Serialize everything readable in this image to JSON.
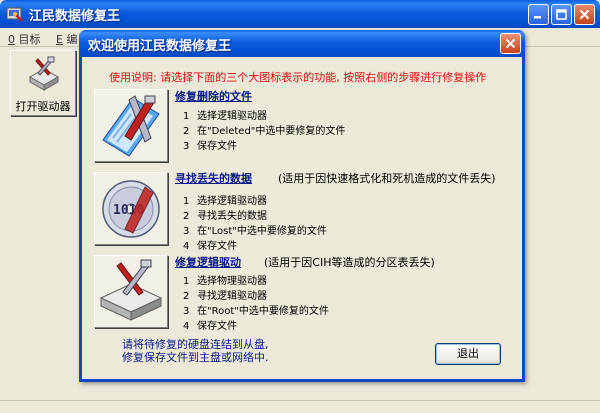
{
  "main_window": {
    "title": "江民数据修复王",
    "menu": [
      {
        "hotkey": "0",
        "label": "目标"
      },
      {
        "hotkey": "E",
        "label": "编"
      }
    ],
    "toolbar": {
      "open_drive_label": "打开驱动器"
    }
  },
  "dialog": {
    "title": "欢迎使用江民数据修复王",
    "instruction": "使用说明: 请选择下面的三个大图标表示的功能, 按照右侧的步骤进行修复操作",
    "sections": [
      {
        "title": "修复删除的文件",
        "note": "",
        "icon": "recycle-document-icon",
        "steps": [
          {
            "num": "1",
            "text": "选择逻辑驱动器"
          },
          {
            "num": "2",
            "text": "在\"Deleted\"中选中要修复的文件"
          },
          {
            "num": "3",
            "text": "保存文件"
          }
        ]
      },
      {
        "title": "寻找丢失的数据",
        "note": "(适用于因快速格式化和死机造成的文件丢失)",
        "icon": "binary-disk-icon",
        "steps": [
          {
            "num": "1",
            "text": "选择逻辑驱动器"
          },
          {
            "num": "2",
            "text": "寻找丢失的数据"
          },
          {
            "num": "3",
            "text": "在\"Lost\"中选中要修复的文件"
          },
          {
            "num": "4",
            "text": "保存文件"
          }
        ]
      },
      {
        "title": "修复逻辑驱动",
        "note": "(适用于因CIH等造成的分区表丢失)",
        "icon": "hard-drive-tools-icon",
        "steps": [
          {
            "num": "1",
            "text": "选择物理驱动器"
          },
          {
            "num": "2",
            "text": "寻找逻辑驱动器"
          },
          {
            "num": "3",
            "text": "在\"Root\"中选中要修复的文件"
          },
          {
            "num": "4",
            "text": "保存文件"
          }
        ]
      }
    ],
    "note_lines": [
      "请将待修复的硬盘连结到从盘,",
      "修复保存文件到主盘或网络中."
    ],
    "exit_label": "退出"
  },
  "colors": {
    "title_blue": "#0553d6",
    "instruction_red": "#e01010",
    "section_title_navy": "#0a1a8a",
    "window_bg": "#ece9d8"
  }
}
